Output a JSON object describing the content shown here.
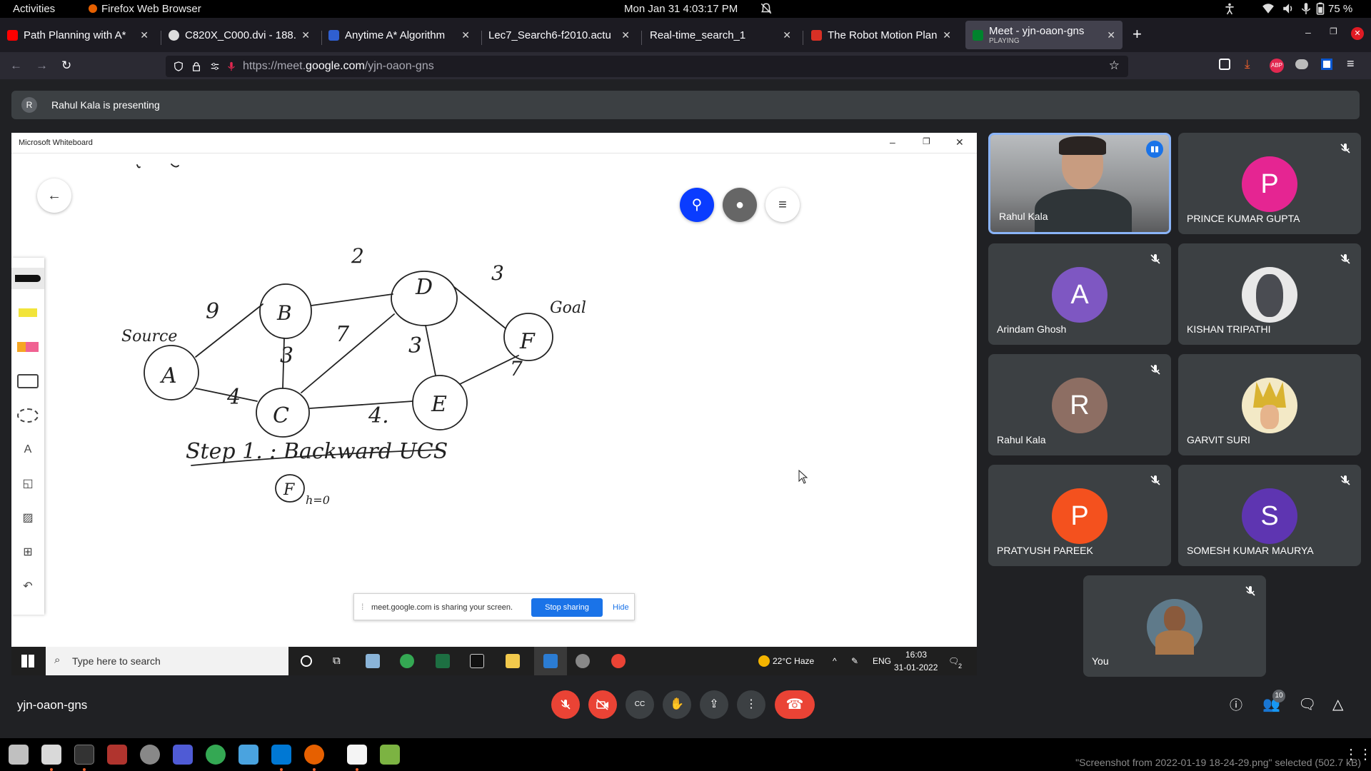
{
  "gnome": {
    "activities": "Activities",
    "app_name": "Firefox Web Browser",
    "clock": "Mon Jan 31  4:03:17 PM",
    "battery": "75 %"
  },
  "browser": {
    "tabs": [
      {
        "title": "Path Planning with A*",
        "favicon_color": "#ff0000"
      },
      {
        "title": "C820X_C000.dvi - 188.",
        "favicon_color": "#dddddd"
      },
      {
        "title": "Anytime A* Algorithm",
        "favicon_color": "#2f5fd0"
      },
      {
        "title": "Lec7_Search6-f2010.actu",
        "favicon_color": "#1c1b22"
      },
      {
        "title": "Real-time_search_1",
        "favicon_color": "#1c1b22"
      },
      {
        "title": "The Robot Motion Plan",
        "favicon_color": "#d93025"
      },
      {
        "title": "Meet - yjn-oaon-gns",
        "subtitle": "PLAYING",
        "favicon_color": "#00832d"
      }
    ],
    "url_prefix": "https://meet.",
    "url_domain": "google.com",
    "url_path": "/yjn-oaon-gns"
  },
  "meet": {
    "presenter_initial": "R",
    "presenting_text": "Rahul Kala is presenting",
    "meeting_code": "yjn-oaon-gns",
    "people_count": "10",
    "participants": [
      {
        "name": "Rahul Kala",
        "type": "video",
        "color": "#8a8f96"
      },
      {
        "name": "PRINCE KUMAR GUPTA",
        "initial": "P",
        "color": "#e52592"
      },
      {
        "name": "Arindam Ghosh",
        "initial": "A",
        "color": "#7e57c2"
      },
      {
        "name": "KISHAN TRIPATHI",
        "type": "photo",
        "color": "#6b6f76"
      },
      {
        "name": "Rahul Kala",
        "initial": "R",
        "color": "#8d6e63"
      },
      {
        "name": "GARVIT SURI",
        "type": "photo",
        "color": "#c9a227"
      },
      {
        "name": "PRATYUSH PAREEK",
        "initial": "P",
        "color": "#f4511e"
      },
      {
        "name": "SOMESH KUMAR MAURYA",
        "initial": "S",
        "color": "#5e35b1"
      },
      {
        "name": "You",
        "type": "photo",
        "color": "#7a6652"
      }
    ]
  },
  "whiteboard": {
    "window_title": "Microsoft Whiteboard",
    "nodes": [
      "A",
      "B",
      "D",
      "F",
      "C",
      "E"
    ],
    "edge_weights": [
      "9",
      "2",
      "3",
      "3",
      "7",
      "3",
      "4",
      "4.",
      "7"
    ],
    "source_label": "Source",
    "goal_label": "Goal",
    "step_text": "Step 1. : Backward UCS",
    "step_node": "F",
    "step_h": "h=0"
  },
  "screenshare_notice": {
    "text": "meet.google.com is sharing your screen.",
    "stop": "Stop sharing",
    "hide": "Hide"
  },
  "windows_taskbar": {
    "search_placeholder": "Type here to search",
    "weather": "22°C  Haze",
    "lang": "ENG",
    "time": "16:03",
    "date": "31-01-2022",
    "notif": "2"
  },
  "dock": {
    "status_text": "\"Screenshot from 2022-01-19 18-24-29.png\" selected (502.7 kB)"
  }
}
